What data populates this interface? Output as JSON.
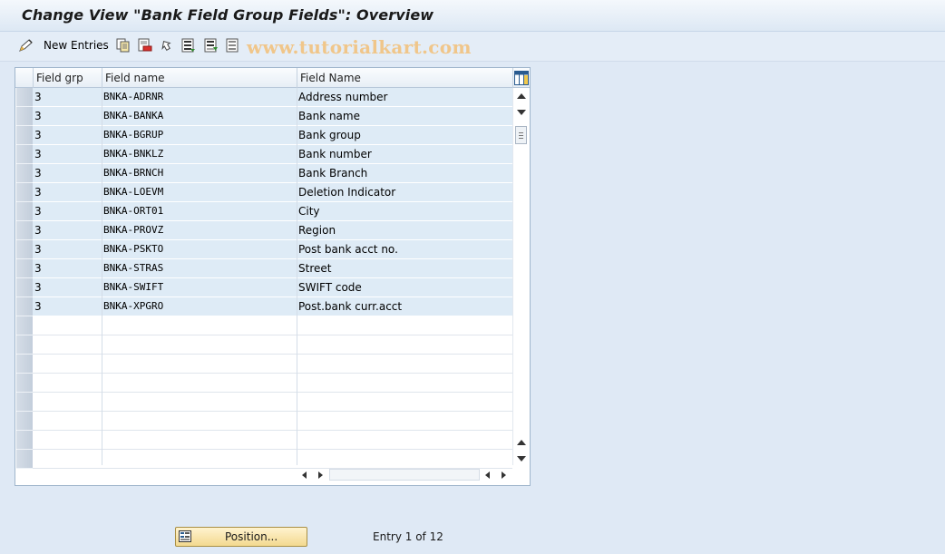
{
  "title": "Change View \"Bank Field Group Fields\": Overview",
  "toolbar": {
    "new_entries_label": "New Entries",
    "watermark": "www.tutorialkart.com"
  },
  "table": {
    "columns": [
      "Field grp",
      "Field name",
      "Field Name"
    ],
    "rows": [
      {
        "grp": "3",
        "field": "BNKA-ADRNR",
        "desc": "Address number"
      },
      {
        "grp": "3",
        "field": "BNKA-BANKA",
        "desc": "Bank name"
      },
      {
        "grp": "3",
        "field": "BNKA-BGRUP",
        "desc": "Bank group"
      },
      {
        "grp": "3",
        "field": "BNKA-BNKLZ",
        "desc": "Bank number"
      },
      {
        "grp": "3",
        "field": "BNKA-BRNCH",
        "desc": "Bank Branch"
      },
      {
        "grp": "3",
        "field": "BNKA-LOEVM",
        "desc": "Deletion Indicator"
      },
      {
        "grp": "3",
        "field": "BNKA-ORT01",
        "desc": "City"
      },
      {
        "grp": "3",
        "field": "BNKA-PROVZ",
        "desc": "Region"
      },
      {
        "grp": "3",
        "field": "BNKA-PSKTO",
        "desc": "Post bank acct no."
      },
      {
        "grp": "3",
        "field": "BNKA-STRAS",
        "desc": "Street"
      },
      {
        "grp": "3",
        "field": "BNKA-SWIFT",
        "desc": "SWIFT code"
      },
      {
        "grp": "3",
        "field": "BNKA-XPGRO",
        "desc": "Post.bank curr.acct"
      }
    ],
    "empty_rows": 8
  },
  "footer": {
    "position_label": "Position...",
    "entry_text": "Entry 1 of 12"
  },
  "icons": [
    "edit-pencil-icon",
    "copy-icon",
    "delete-icon",
    "undo-icon",
    "select-all-icon",
    "select-block-icon",
    "deselect-all-icon",
    "table-settings-icon",
    "position-icon"
  ],
  "colors": {
    "row_fill": "#deebf6",
    "button": "#f3d98f",
    "watermark": "#f0c68a"
  }
}
